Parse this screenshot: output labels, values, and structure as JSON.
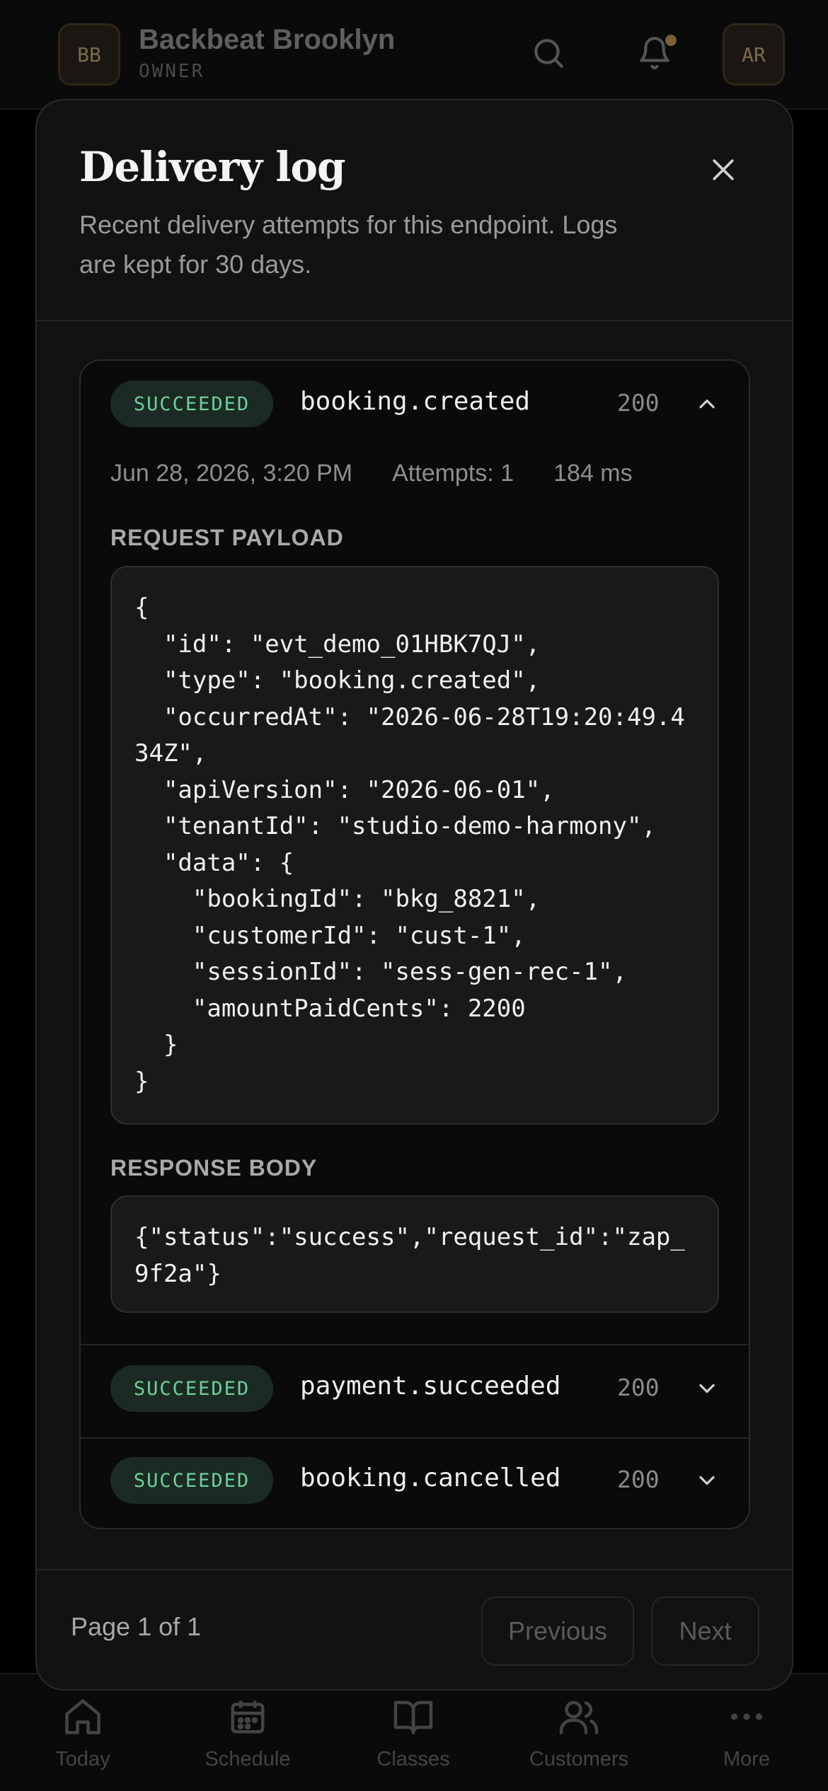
{
  "header": {
    "brand_initials": "BB",
    "brand_name": "Backbeat Brooklyn",
    "role": "OWNER",
    "avatar_initials": "AR"
  },
  "bottom_nav": [
    {
      "label": "Today",
      "icon": "home-icon"
    },
    {
      "label": "Schedule",
      "icon": "calendar-icon"
    },
    {
      "label": "Classes",
      "icon": "book-icon"
    },
    {
      "label": "Customers",
      "icon": "users-icon"
    },
    {
      "label": "More",
      "icon": "more-icon"
    }
  ],
  "modal": {
    "title": "Delivery log",
    "description": "Recent delivery attempts for this endpoint. Logs are kept for 30 days.",
    "logs": [
      {
        "status": "SUCCEEDED",
        "event": "booking.created",
        "code": "200",
        "expanded": true,
        "timestamp": "Jun 28, 2026, 3:20 PM",
        "attempts": "Attempts: 1",
        "duration": "184 ms",
        "request_label": "REQUEST PAYLOAD",
        "request_payload": "{\n  \"id\": \"evt_demo_01HBK7QJ\",\n  \"type\": \"booking.created\",\n  \"occurredAt\": \"2026-06-28T19:20:49.434Z\",\n  \"apiVersion\": \"2026-06-01\",\n  \"tenantId\": \"studio-demo-harmony\",\n  \"data\": {\n    \"bookingId\": \"bkg_8821\",\n    \"customerId\": \"cust-1\",\n    \"sessionId\": \"sess-gen-rec-1\",\n    \"amountPaidCents\": 2200\n  }\n}",
        "response_label": "RESPONSE BODY",
        "response_body": "{\"status\":\"success\",\"request_id\":\"zap_9f2a\"}"
      },
      {
        "status": "SUCCEEDED",
        "event": "payment.succeeded",
        "code": "200",
        "expanded": false
      },
      {
        "status": "SUCCEEDED",
        "event": "booking.cancelled",
        "code": "200",
        "expanded": false
      }
    ],
    "pagination": {
      "page_info": "Page 1 of 1",
      "previous_label": "Previous",
      "next_label": "Next"
    }
  },
  "colors": {
    "success_text": "#6fcf9b",
    "success_bg": "#1b2a24",
    "brand_accent": "#7a6035"
  }
}
